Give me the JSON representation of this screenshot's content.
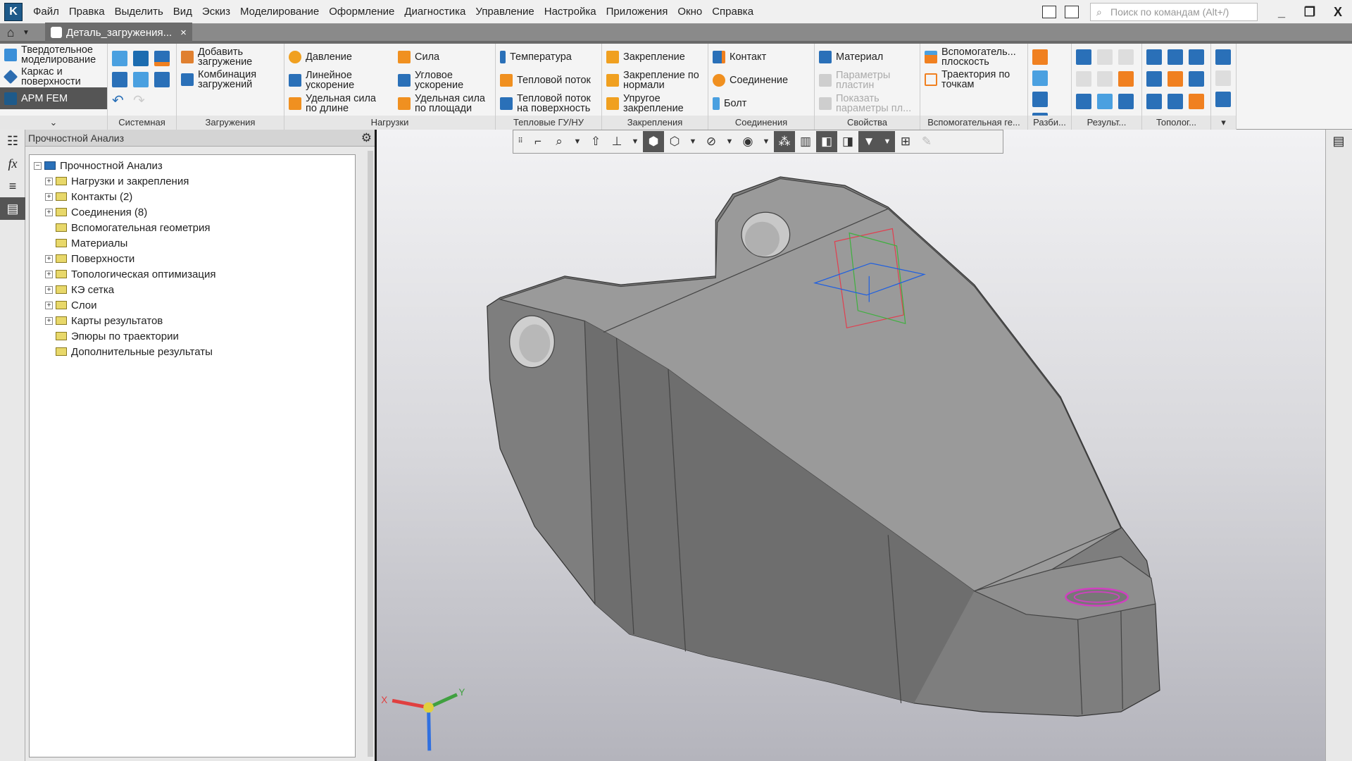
{
  "menu": [
    "Файл",
    "Правка",
    "Выделить",
    "Вид",
    "Эскиз",
    "Моделирование",
    "Оформление",
    "Диагностика",
    "Управление",
    "Настройка",
    "Приложения",
    "Окно",
    "Справка"
  ],
  "search_placeholder": "Поиск по командам (Alt+/)",
  "window_controls": {
    "minimize": "_",
    "restore": "❐",
    "close": "X"
  },
  "tab": {
    "title": "Деталь_загружения...",
    "close": "×"
  },
  "ribbon": {
    "modes": [
      "Твердотельное моделирование",
      "Каркас и поверхности",
      "APM FEM"
    ],
    "groups": {
      "system": "Системная",
      "loadcases": "Загружения",
      "loads": "Нагрузки",
      "thermal": "Тепловые ГУ/НУ",
      "supports": "Закрепления",
      "connections": "Соединения",
      "properties": "Свойства",
      "aux": "Вспомогательная ге...",
      "mesh": "Разби...",
      "results": "Результ...",
      "topology": "Тополог..."
    },
    "loadcases": [
      "Добавить загружение",
      "Комбинация загружений"
    ],
    "loads": [
      "Давление",
      "Линейное ускорение",
      "Удельная сила по длине",
      "Сила",
      "Угловое ускорение",
      "Удельная сила по площади"
    ],
    "thermal": [
      "Температура",
      "Тепловой поток",
      "Тепловой поток на поверхность"
    ],
    "supports": [
      "Закрепление",
      "Закрепление по нормали",
      "Упругое закрепление"
    ],
    "connections": [
      "Контакт",
      "Соединение",
      "Болт"
    ],
    "properties": [
      "Материал",
      "Параметры пластин",
      "Показать параметры пл..."
    ],
    "aux": [
      "Вспомогатель... плоскость",
      "Траектория по точкам"
    ]
  },
  "panel": {
    "title": "Прочностной Анализ",
    "root": "Прочностной Анализ",
    "items": [
      {
        "label": "Нагрузки и закрепления",
        "expandable": true
      },
      {
        "label": "Контакты (2)",
        "expandable": true
      },
      {
        "label": "Соединения (8)",
        "expandable": true
      },
      {
        "label": "Вспомогательная геометрия",
        "expandable": false
      },
      {
        "label": "Материалы",
        "expandable": false
      },
      {
        "label": "Поверхности",
        "expandable": true
      },
      {
        "label": "Топологическая оптимизация",
        "expandable": true
      },
      {
        "label": "КЭ сетка",
        "expandable": true
      },
      {
        "label": "Слои",
        "expandable": true
      },
      {
        "label": "Карты результатов",
        "expandable": true
      },
      {
        "label": "Эпюры по траектории",
        "expandable": false
      },
      {
        "label": "Дополнительные результаты",
        "expandable": false
      }
    ]
  },
  "axes": {
    "x": "X",
    "y": "Y"
  },
  "colors": {
    "accent": "#1e5a8a",
    "model": "#8c8c8c",
    "hole_highlight": "#d040c0"
  }
}
